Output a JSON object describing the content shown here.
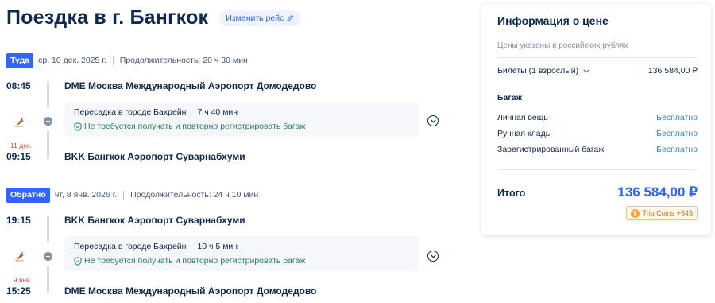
{
  "header": {
    "title": "Поездка в г. Бангкок",
    "change_label": "Изменить рейс"
  },
  "outbound": {
    "tag": "Туда",
    "date": "ср, 10 дек. 2025 г.",
    "duration": "Продолжительность: 20 ч 30 мин",
    "dep_time": "08:45",
    "dep_airport": "DME Москва Международный Аэропорт Домодедово",
    "transfer_city": "Пересадка в городе Бахрейн",
    "transfer_duration": "7 ч 40 мин",
    "baggage_note": "Не требуется получать и повторно регистрировать багаж",
    "arr_date_note": "11 дек.",
    "arr_time": "09:15",
    "arr_airport": "BKK Бангкок Аэропорт Суварнабхуми"
  },
  "inbound": {
    "tag": "Обратно",
    "date": "чт, 8 янв. 2026 г.",
    "duration": "Продолжительность: 24 ч 10 мин",
    "dep_time": "19:15",
    "dep_airport": "BKK Бангкок Аэропорт Суварнабхуми",
    "transfer_city": "Пересадка в городе Бахрейн",
    "transfer_duration": "10 ч 5 мин",
    "baggage_note": "Не требуется получать и повторно регистрировать багаж",
    "arr_date_note": "9 янв.",
    "arr_time": "15:25",
    "arr_airport": "DME Москва Международный Аэропорт Домодедово"
  },
  "price": {
    "title": "Информация о цене",
    "currency_note": "Цены указаны в российских рублях",
    "tickets_label": "Билеты (1 взрослый)",
    "tickets_value": "136 584,00 ₽",
    "baggage_title": "Багаж",
    "personal_item": "Личная вещь",
    "personal_item_value": "Бесплатно",
    "carry_on": "Ручная кладь",
    "carry_on_value": "Бесплатно",
    "checked": "Зарегистрированный багаж",
    "checked_value": "Бесплатно",
    "total_label": "Итого",
    "total_value": "136 584,00 ₽",
    "coins_label": "Trip Coins +543",
    "coin_symbol": "T"
  },
  "colors": {
    "accent": "#3264ff",
    "text": "#0f294d",
    "success": "#287c6a",
    "warning": "#d9453c"
  },
  "icons": {
    "airline": "airline-logo-icon",
    "stop": "stop-dot-icon",
    "shield": "shield-check-icon",
    "expand": "chevron-down-icon",
    "edit": "edit-icon"
  }
}
